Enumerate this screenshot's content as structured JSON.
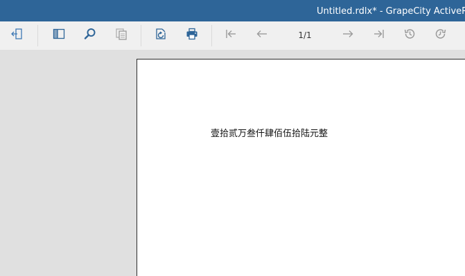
{
  "window": {
    "title": "Untitled.rdlx* - GrapeCity ActiveRepo"
  },
  "toolbar": {
    "page_counter": "1/1",
    "icons": [
      "back-to-parent-icon",
      "toggle-sidebar-icon",
      "search-icon",
      "copy-icon",
      "refresh-icon",
      "print-icon",
      "first-page-icon",
      "previous-page-icon",
      "next-page-icon",
      "last-page-icon",
      "history-back-icon",
      "history-forward-icon"
    ]
  },
  "report": {
    "amount_text": "壹拾贰万叁仟肆佰伍拾陆元整"
  },
  "colors": {
    "titlebar": "#2e6598",
    "toolbar": "#f0f0f0",
    "workspace": "#e0e0e0",
    "icon_blue": "#2e6598",
    "icon_gray": "#9a9a9a"
  }
}
